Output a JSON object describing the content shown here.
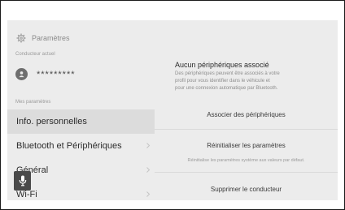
{
  "header": {
    "title": "Paramètres",
    "gear_icon": "gear-icon"
  },
  "driver": {
    "label": "Conducteur actuel",
    "name": "*********"
  },
  "menu": {
    "section_label": "Mes paramètres",
    "items": [
      {
        "label": "Info. personnelles",
        "selected": true
      },
      {
        "label": "Bluetooth et Périphériques"
      },
      {
        "label": "Général"
      },
      {
        "label": "Wi-Fi"
      }
    ]
  },
  "voice": {
    "icon": "microphone-icon"
  },
  "detail": {
    "heading": "Aucun périphériques associé",
    "desc_lines": [
      "Des périphériques peuvent être associés à votre",
      "profil pour vous identifier dans le véhicule et",
      "pour une connexion automatique par Bluetooth."
    ],
    "pair_label": "Associer des périphériques",
    "reset_label": "Réinitialiser les paramètres",
    "reset_desc": "Réinitialise les paramètres système aux valeurs par défaut.",
    "delete_label": "Supprimer le conducteur"
  }
}
